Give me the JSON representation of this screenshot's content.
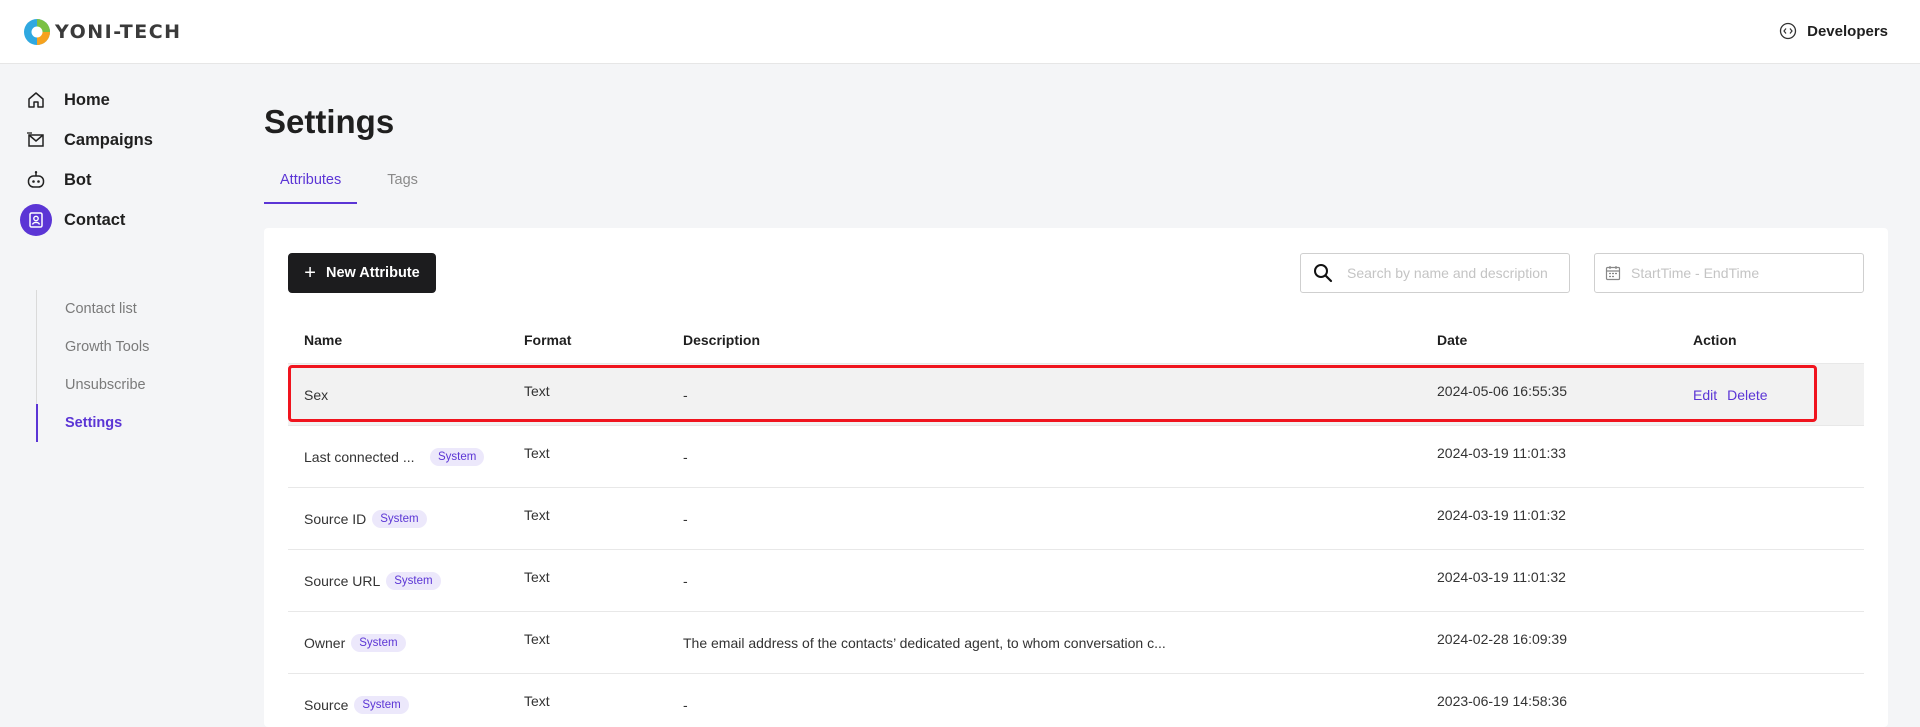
{
  "app": {
    "brand": "YONI-TECH",
    "developers_label": "Developers"
  },
  "sidebar": {
    "items": [
      {
        "label": "Home",
        "icon": "home-icon"
      },
      {
        "label": "Campaigns",
        "icon": "campaigns-icon"
      },
      {
        "label": "Bot",
        "icon": "bot-icon"
      },
      {
        "label": "Contact",
        "icon": "contact-icon",
        "active": true
      }
    ],
    "subitems": [
      {
        "label": "Contact list"
      },
      {
        "label": "Growth Tools"
      },
      {
        "label": "Unsubscribe"
      },
      {
        "label": "Settings",
        "active": true
      }
    ]
  },
  "page": {
    "title": "Settings",
    "tabs": [
      {
        "label": "Attributes",
        "active": true
      },
      {
        "label": "Tags"
      }
    ]
  },
  "toolbar": {
    "new_attribute_label": "New Attribute",
    "search_placeholder": "Search by name and description",
    "date_placeholder": "StartTime - EndTime"
  },
  "table": {
    "headers": {
      "name": "Name",
      "format": "Format",
      "description": "Description",
      "date": "Date",
      "action": "Action"
    },
    "rows": [
      {
        "name": "Sex",
        "badge": "",
        "format": "Text",
        "description": "-",
        "date": "2024-05-06 16:55:35",
        "edit": "Edit",
        "delete": "Delete"
      },
      {
        "name": "Last connected ...",
        "badge": "System",
        "format": "Text",
        "description": "-",
        "date": "2024-03-19 11:01:33"
      },
      {
        "name": "Source ID",
        "badge": "System",
        "format": "Text",
        "description": "-",
        "date": "2024-03-19 11:01:32"
      },
      {
        "name": "Source URL",
        "badge": "System",
        "format": "Text",
        "description": "-",
        "date": "2024-03-19 11:01:32"
      },
      {
        "name": "Owner",
        "badge": "System",
        "format": "Text",
        "description": "The email address of the contacts’ dedicated agent, to whom conversation c...",
        "date": "2024-02-28 16:09:39"
      },
      {
        "name": "Source",
        "badge": "System",
        "format": "Text",
        "description": "-",
        "date": "2023-06-19 14:58:36"
      }
    ]
  },
  "colors": {
    "accent": "#5b35d5",
    "highlight": "#f0141e",
    "badge_bg": "#ece8fb"
  }
}
